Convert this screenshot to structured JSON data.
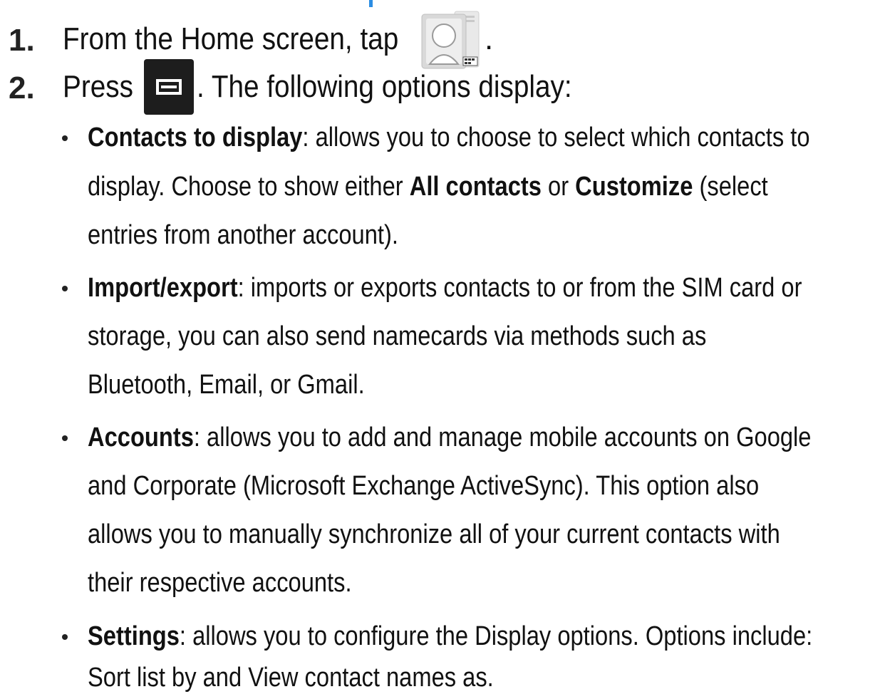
{
  "step1": {
    "number": "1.",
    "text_before_icon": "From the Home screen, tap",
    "text_after_icon": ".",
    "icon": "contacts-app-icon"
  },
  "step2": {
    "number": "2.",
    "text_before_icon": "Press",
    "text_after_icon": ". The following options display:",
    "icon": "menu-key-icon"
  },
  "options": [
    {
      "term": "Contacts to display",
      "line1": ": allows you to choose to select which contacts to",
      "line2_a": "display. Choose to show either ",
      "line2_b": "All contacts",
      "line2_c": " or ",
      "line2_d": "Customize",
      "line2_e": " (select",
      "line3": "entries from another account)."
    },
    {
      "term": "Import/export",
      "line1": ": imports or exports contacts to or from the SIM card or",
      "line2": "storage, you can also send namecards via methods such as",
      "line3": "Bluetooth, Email, or Gmail."
    },
    {
      "term": "Accounts",
      "line1": ": allows you to add and manage mobile accounts on Google",
      "line2": "and Corporate (Microsoft Exchange ActiveSync). This option also",
      "line3": "allows you to manually synchronize all of your current contacts with",
      "line4": "their respective accounts."
    },
    {
      "term": "Settings",
      "line1": ": allows you to configure the Display options. Options include:",
      "line2": "Sort list by and View contact names as."
    }
  ]
}
